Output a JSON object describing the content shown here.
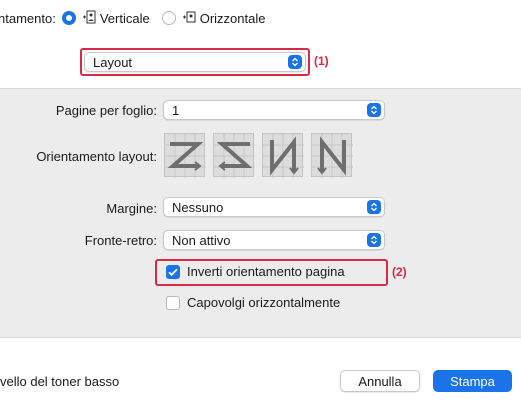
{
  "orientation": {
    "label": "ntamento:",
    "options": [
      {
        "label": "Verticale",
        "selected": true,
        "icon": "portrait-icon"
      },
      {
        "label": "Orizzontale",
        "selected": false,
        "icon": "landscape-icon"
      }
    ]
  },
  "section_popup": {
    "value": "Layout",
    "callout": "(1)"
  },
  "layout": {
    "pages_per_sheet": {
      "label": "Pagine per foglio:",
      "value": "1"
    },
    "layout_direction": {
      "label": "Orientamento layout:",
      "options": [
        "z-left-to-right",
        "reverse-z-right-to-left",
        "n-top-to-bottom",
        "reverse-n"
      ]
    },
    "border": {
      "label": "Margine:",
      "value": "Nessuno"
    },
    "two_sided": {
      "label": "Fronte-retro:",
      "value": "Non attivo"
    },
    "reverse_orientation": {
      "label": "Inverti orientamento pagina",
      "checked": true,
      "callout": "(2)"
    },
    "flip_horizontal": {
      "label": "Capovolgi orizzontalmente",
      "checked": false
    }
  },
  "footer": {
    "status": "vello del toner basso",
    "cancel": "Annulla",
    "print": "Stampa"
  },
  "colors": {
    "accent": "#1a73e8",
    "highlight": "#d62b46",
    "panel": "#ececec"
  }
}
